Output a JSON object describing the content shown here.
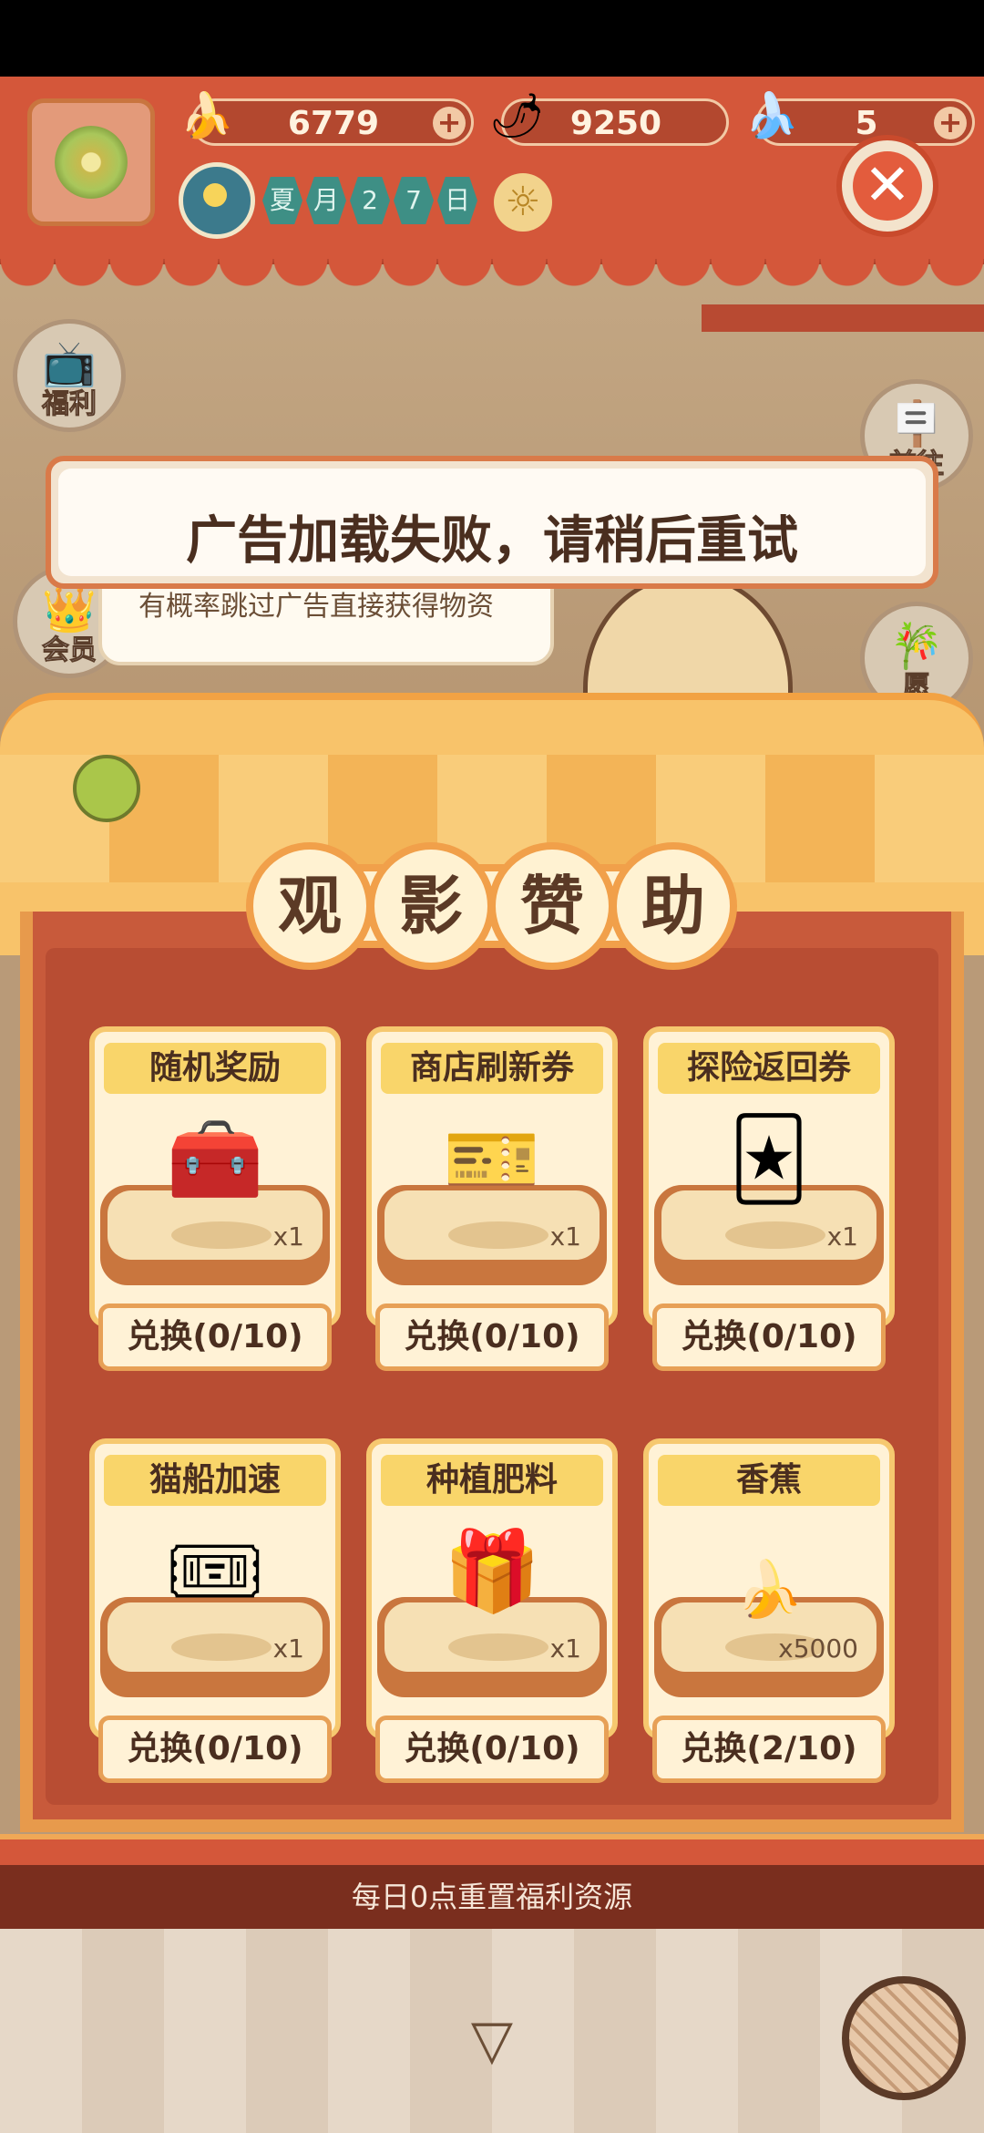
{
  "header": {
    "resources": [
      {
        "name": "banana",
        "icon": "banana-icon",
        "value": "6779"
      },
      {
        "name": "pepper",
        "icon": "fire-pepper-icon",
        "value": "9250"
      },
      {
        "name": "blue-banana",
        "icon": "blue-banana-icon",
        "value": "5"
      }
    ],
    "date_chars": [
      "夏",
      "月",
      "2",
      "7",
      "日"
    ]
  },
  "side_nav": {
    "welfare_label": "福利",
    "member_label": "会员",
    "right_label_1": "前往",
    "right_label_2": "愿"
  },
  "bubble_text": "有概率跳过广告直接获得物资",
  "toast": {
    "message": "广告加载失败，请稍后重试"
  },
  "panel": {
    "title_chars": [
      "观",
      "影",
      "赞",
      "助"
    ],
    "rewards": [
      {
        "name": "随机奖励",
        "icon": "treasure-chest-icon",
        "quantity": "x1",
        "exchange": "兑换(0/10)"
      },
      {
        "name": "商店刷新券",
        "icon": "refresh-ticket-icon",
        "quantity": "x1",
        "exchange": "兑换(0/10)"
      },
      {
        "name": "探险返回券",
        "icon": "return-card-icon",
        "quantity": "x1",
        "exchange": "兑换(0/10)"
      },
      {
        "name": "猫船加速",
        "icon": "speed-tickets-icon",
        "quantity": "x1",
        "exchange": "兑换(0/10)"
      },
      {
        "name": "种植肥料",
        "icon": "fertilizer-bag-icon",
        "quantity": "x1",
        "exchange": "兑换(0/10)"
      },
      {
        "name": "香蕉",
        "icon": "banana-icon",
        "quantity": "x5000",
        "exchange": "兑换(2/10)"
      }
    ],
    "footer_note": "每日0点重置福利资源"
  },
  "colors": {
    "header_red": "#d4573a",
    "panel_red": "#c85a3b",
    "card_cream": "#fff2d6",
    "accent_orange": "#e79a4c"
  }
}
